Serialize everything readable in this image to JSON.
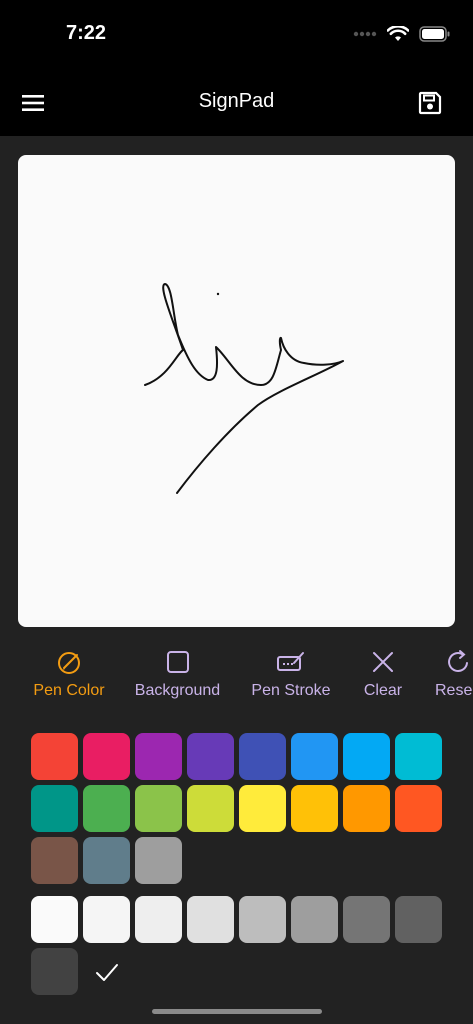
{
  "status": {
    "time": "7:22"
  },
  "app": {
    "title": "SignPad"
  },
  "icons": {
    "menu": "menu-icon",
    "save": "save-icon",
    "pen_color": "pen-color-icon",
    "background": "background-icon",
    "pen_stroke": "pen-stroke-icon",
    "clear": "clear-icon",
    "reset": "reset-icon",
    "check": "check-icon"
  },
  "toolbar": {
    "items": [
      {
        "label": "Pen Color",
        "active": true
      },
      {
        "label": "Background",
        "active": false
      },
      {
        "label": "Pen Stroke",
        "active": false
      },
      {
        "label": "Clear",
        "active": false
      },
      {
        "label": "Rese",
        "active": false
      }
    ]
  },
  "colors": {
    "accent": "#f39c12",
    "inactive_tool": "#c9b3e8",
    "canvas": "#fafafa",
    "ink": "#111111"
  },
  "palette": {
    "colors": [
      "#f44336",
      "#e91e63",
      "#9c27b0",
      "#673ab7",
      "#3f51b5",
      "#2196f3",
      "#03a9f4",
      "#00bcd4",
      "#009688",
      "#4caf50",
      "#8bc34a",
      "#cddc39",
      "#ffeb3b",
      "#ffc107",
      "#ff9800",
      "#ff5722",
      "#795548",
      "#607d8b",
      "#9e9e9e"
    ],
    "grays": [
      "#fafafa",
      "#f5f5f5",
      "#eeeeee",
      "#e0e0e0",
      "#bdbdbd",
      "#9e9e9e",
      "#757575",
      "#616161",
      "#424242"
    ],
    "selected_index": 0
  }
}
